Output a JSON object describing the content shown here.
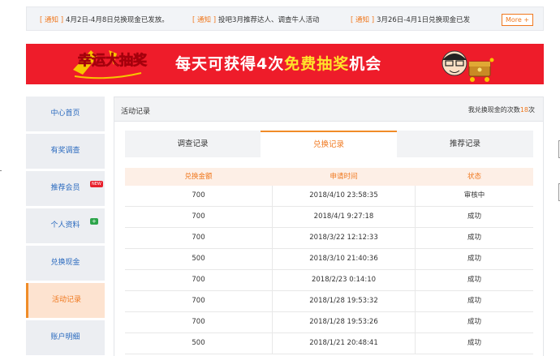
{
  "notices": [
    {
      "tag": "[ 通知 ]",
      "text": "4月2日-4月8日兑换现金已发放。"
    },
    {
      "tag": "[ 通知 ]",
      "text": "投吧3月推荐达人、调查牛人活动"
    },
    {
      "tag": "[ 通知 ]",
      "text": "3月26日-4月1日兑换现金已发"
    }
  ],
  "more_label": "More +",
  "banner": {
    "logo_text": "幸运大抽奖",
    "slogan_pre": "每天可获得4次",
    "slogan_hl": "免费抽奖",
    "slogan_post": "机会"
  },
  "sidebar": {
    "items": [
      {
        "label": "中心首页"
      },
      {
        "label": "有奖调查"
      },
      {
        "label": "推荐会员",
        "badge": "NEW"
      },
      {
        "label": "个人资料",
        "badge": "+"
      },
      {
        "label": "兑换现金"
      },
      {
        "label": "活动记录"
      },
      {
        "label": "账户明细"
      }
    ]
  },
  "main": {
    "title": "活动记录",
    "exchange_prefix": "我兑换现金的次数",
    "exchange_count": "18",
    "exchange_suffix": "次"
  },
  "tabs": [
    {
      "label": "调查记录"
    },
    {
      "label": "兑换记录"
    },
    {
      "label": "推荐记录"
    }
  ],
  "table": {
    "headers": [
      "兑换金额",
      "申请时间",
      "状态"
    ],
    "rows": [
      [
        "700",
        "2018/4/10 23:58:35",
        "审核中"
      ],
      [
        "700",
        "2018/4/1 9:27:18",
        "成功"
      ],
      [
        "700",
        "2018/3/22 12:12:33",
        "成功"
      ],
      [
        "500",
        "2018/3/10 21:40:36",
        "成功"
      ],
      [
        "700",
        "2018/2/23 0:14:10",
        "成功"
      ],
      [
        "700",
        "2018/1/28 19:53:32",
        "成功"
      ],
      [
        "700",
        "2018/1/28 19:53:26",
        "成功"
      ],
      [
        "500",
        "2018/1/21 20:48:41",
        "成功"
      ]
    ]
  },
  "colors": {
    "accent": "#f0781e",
    "banner_bg": "#ee1c2a",
    "link_blue": "#2b6bbf"
  }
}
